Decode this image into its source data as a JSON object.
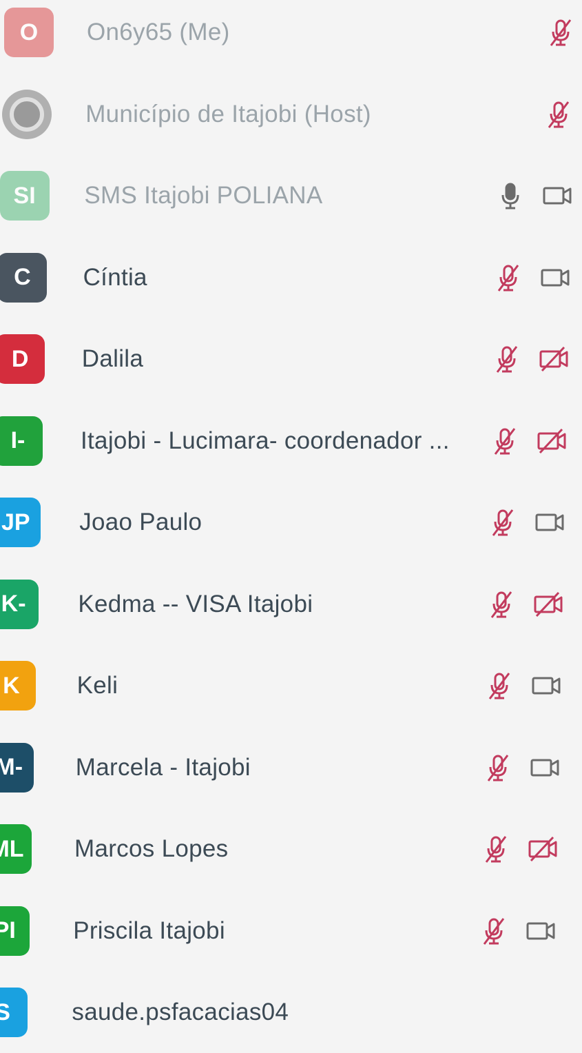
{
  "colors": {
    "muted_red": "#c23b5e",
    "icon_gray": "#6b6b6b"
  },
  "participants": [
    {
      "initials": "O",
      "name": "On6y65 (Me)",
      "avatar_color": "#e0787a",
      "mic": "mic-muted-icon",
      "video": null,
      "faded": true
    },
    {
      "initials": "",
      "name": "Município de Itajobi (Host)",
      "avatar_color": "logo",
      "mic": "mic-muted-icon",
      "video": null,
      "faded": true
    },
    {
      "initials": "SI",
      "name": "SMS Itajobi POLIANA",
      "avatar_color": "#7ec89b",
      "mic": "mic-icon",
      "video": "video-icon",
      "faded": true
    },
    {
      "initials": "C",
      "name": "Cíntia",
      "avatar_color": "#4a5560",
      "mic": "mic-muted-icon",
      "video": "video-icon",
      "faded": false
    },
    {
      "initials": "D",
      "name": "Dalila",
      "avatar_color": "#d42d3d",
      "mic": "mic-muted-icon",
      "video": "video-off-icon",
      "faded": false
    },
    {
      "initials": "I-",
      "name": "Itajobi - Lucimara- coordenador ...",
      "avatar_color": "#21a23c",
      "mic": "mic-muted-icon",
      "video": "video-off-icon",
      "faded": false
    },
    {
      "initials": "JP",
      "name": "Joao Paulo",
      "avatar_color": "#1aa1e0",
      "mic": "mic-muted-icon",
      "video": "video-icon",
      "faded": false
    },
    {
      "initials": "K-",
      "name": "Kedma -- VISA Itajobi",
      "avatar_color": "#1aa567",
      "mic": "mic-muted-icon",
      "video": "video-off-icon",
      "faded": false
    },
    {
      "initials": "K",
      "name": "Keli",
      "avatar_color": "#f2a20f",
      "mic": "mic-muted-icon",
      "video": "video-icon",
      "faded": false
    },
    {
      "initials": "M-",
      "name": "Marcela - Itajobi",
      "avatar_color": "#1d4e68",
      "mic": "mic-muted-icon",
      "video": "video-icon",
      "faded": false
    },
    {
      "initials": "ML",
      "name": "Marcos Lopes",
      "avatar_color": "#1ca63a",
      "mic": "mic-muted-icon",
      "video": "video-off-icon",
      "faded": false
    },
    {
      "initials": "PI",
      "name": "Priscila Itajobi",
      "avatar_color": "#1ca63a",
      "mic": "mic-muted-icon",
      "video": "video-icon",
      "faded": false
    },
    {
      "initials": "S",
      "name": "saude.psfacacias04",
      "avatar_color": "#1aa1e0",
      "mic": null,
      "video": null,
      "faded": false
    }
  ]
}
